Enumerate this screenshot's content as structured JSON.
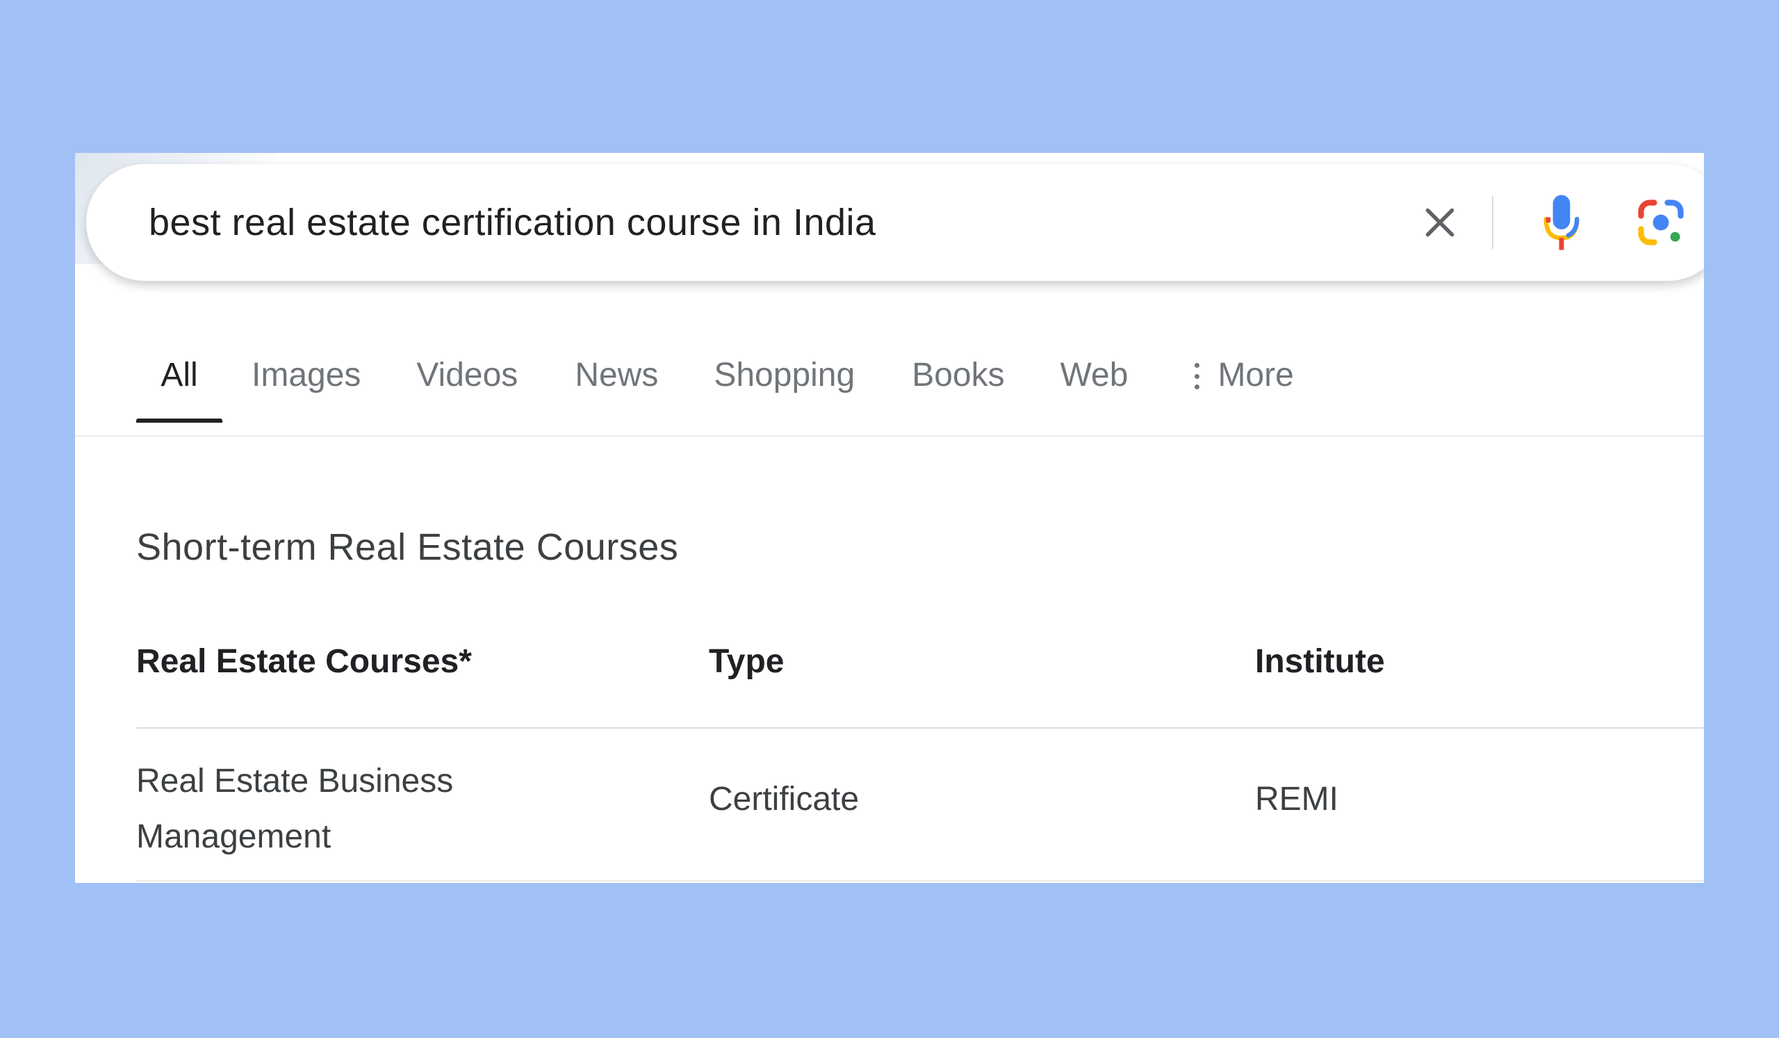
{
  "search": {
    "query": "best real estate certification course in India",
    "icons": {
      "clear": "close-icon",
      "voice": "microphone-icon",
      "lens": "google-lens-icon"
    }
  },
  "tabs": [
    {
      "label": "All",
      "active": true
    },
    {
      "label": "Images",
      "active": false
    },
    {
      "label": "Videos",
      "active": false
    },
    {
      "label": "News",
      "active": false
    },
    {
      "label": "Shopping",
      "active": false
    },
    {
      "label": "Books",
      "active": false
    },
    {
      "label": "Web",
      "active": false
    },
    {
      "label": "More",
      "active": false,
      "icon": "more-vertical-icon"
    }
  ],
  "section": {
    "title": "Short-term Real Estate Courses"
  },
  "table": {
    "headers": [
      "Real Estate Courses*",
      "Type",
      "Institute"
    ],
    "rows": [
      [
        "Real Estate Business Management",
        "Certificate",
        "REMI"
      ]
    ]
  },
  "colors": {
    "page_background": "#a0c0f6",
    "card_background": "#ffffff",
    "mic_blue": "#4285f4",
    "mic_red": "#ea4335",
    "lens_yellow": "#fbbc04",
    "lens_green": "#34a853",
    "text_primary": "#202124",
    "text_secondary": "#70757a"
  }
}
